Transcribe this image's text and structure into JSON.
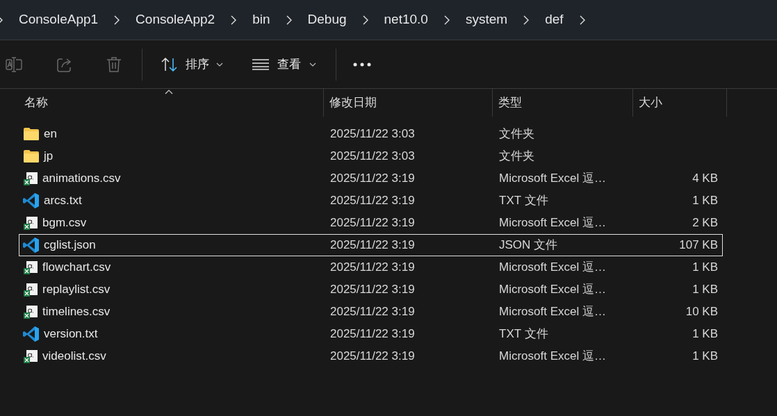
{
  "breadcrumb": [
    "ConsoleApp1",
    "ConsoleApp2",
    "bin",
    "Debug",
    "net10.0",
    "system",
    "def"
  ],
  "toolbar": {
    "rename_disabled": true,
    "share_disabled": true,
    "delete_disabled": true,
    "sort": {
      "label": "排序"
    },
    "view": {
      "label": "查看"
    }
  },
  "table": {
    "columns": [
      "名称",
      "修改日期",
      "类型",
      "大小"
    ],
    "rows": [
      {
        "kind": "folder",
        "name": "en",
        "modified": "2025/11/22 3:03",
        "type": "文件夹",
        "selected": false
      },
      {
        "kind": "folder",
        "name": "jp",
        "modified": "2025/11/22 3:03",
        "type": "文件夹",
        "selected": false
      },
      {
        "kind": "excel",
        "name": "animations.csv",
        "modified": "2025/11/22 3:19",
        "type": "Microsoft Excel 逗…",
        "size": "4 KB",
        "selected": false
      },
      {
        "kind": "vscode",
        "name": "arcs.txt",
        "modified": "2025/11/22 3:19",
        "type": "TXT 文件",
        "size": "1 KB",
        "selected": false
      },
      {
        "kind": "excel",
        "name": "bgm.csv",
        "modified": "2025/11/22 3:19",
        "type": "Microsoft Excel 逗…",
        "size": "2 KB",
        "selected": false
      },
      {
        "kind": "vscode",
        "name": "cglist.json",
        "modified": "2025/11/22 3:19",
        "type": "JSON 文件",
        "size": "107 KB",
        "selected": true
      },
      {
        "kind": "excel",
        "name": "flowchart.csv",
        "modified": "2025/11/22 3:19",
        "type": "Microsoft Excel 逗…",
        "size": "1 KB",
        "selected": false
      },
      {
        "kind": "excel",
        "name": "replaylist.csv",
        "modified": "2025/11/22 3:19",
        "type": "Microsoft Excel 逗…",
        "size": "1 KB",
        "selected": false
      },
      {
        "kind": "excel",
        "name": "timelines.csv",
        "modified": "2025/11/22 3:19",
        "type": "Microsoft Excel 逗…",
        "size": "10 KB",
        "selected": false
      },
      {
        "kind": "vscode",
        "name": "version.txt",
        "modified": "2025/11/22 3:19",
        "type": "TXT 文件",
        "size": "1 KB",
        "selected": false
      },
      {
        "kind": "excel",
        "name": "videolist.csv",
        "modified": "2025/11/22 3:19",
        "type": "Microsoft Excel 逗…",
        "size": "1 KB",
        "selected": false
      }
    ]
  }
}
